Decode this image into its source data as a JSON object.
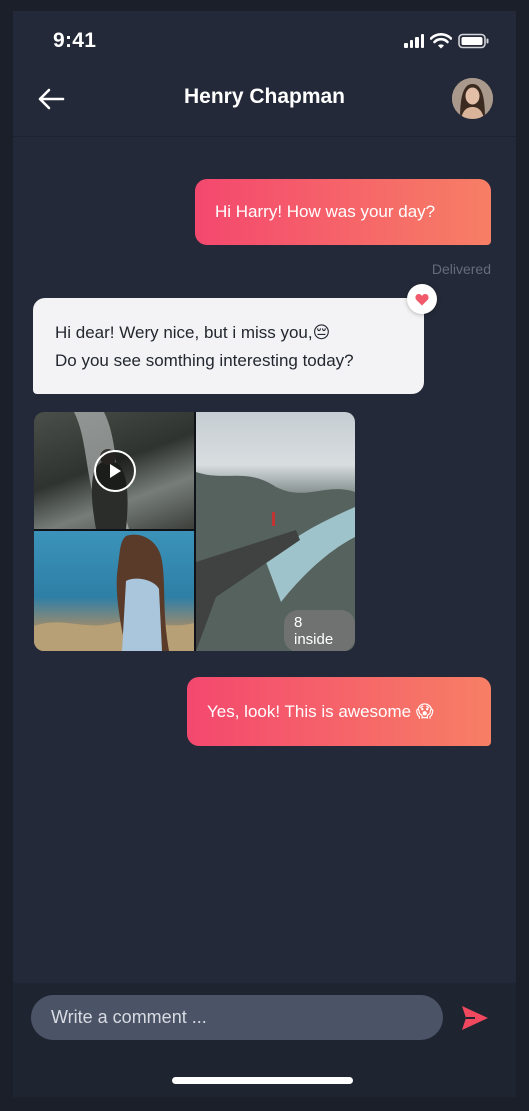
{
  "status_bar": {
    "time": "9:41",
    "icons": [
      "signal-icon",
      "wifi-icon",
      "battery-icon"
    ]
  },
  "header": {
    "title": "Henry Chapman",
    "back_icon": "arrow-left-icon",
    "avatar_icon": "contact-avatar"
  },
  "messages": [
    {
      "direction": "outgoing",
      "text": "Hi Harry! How was your day?"
    },
    {
      "direction": "incoming",
      "lines": [
        "Hi dear! Wery nice, but i miss you,😔",
        "Do you see somthing interesting today?"
      ],
      "reaction": "heart-icon"
    },
    {
      "direction": "incoming",
      "type": "media",
      "count_label": "8 inside",
      "icons": [
        "play-icon"
      ]
    },
    {
      "direction": "outgoing",
      "text": "Yes, look! This is awesome 😱"
    }
  ],
  "delivered_label": "Delivered",
  "composer": {
    "placeholder": "Write a comment ...",
    "send_icon": "send-icon"
  },
  "colors": {
    "background": "#232938",
    "accent_start": "#f4486e",
    "accent_end": "#f77f65",
    "incoming_bubble": "#f3f3f5",
    "input_bg": "#4b5366"
  }
}
